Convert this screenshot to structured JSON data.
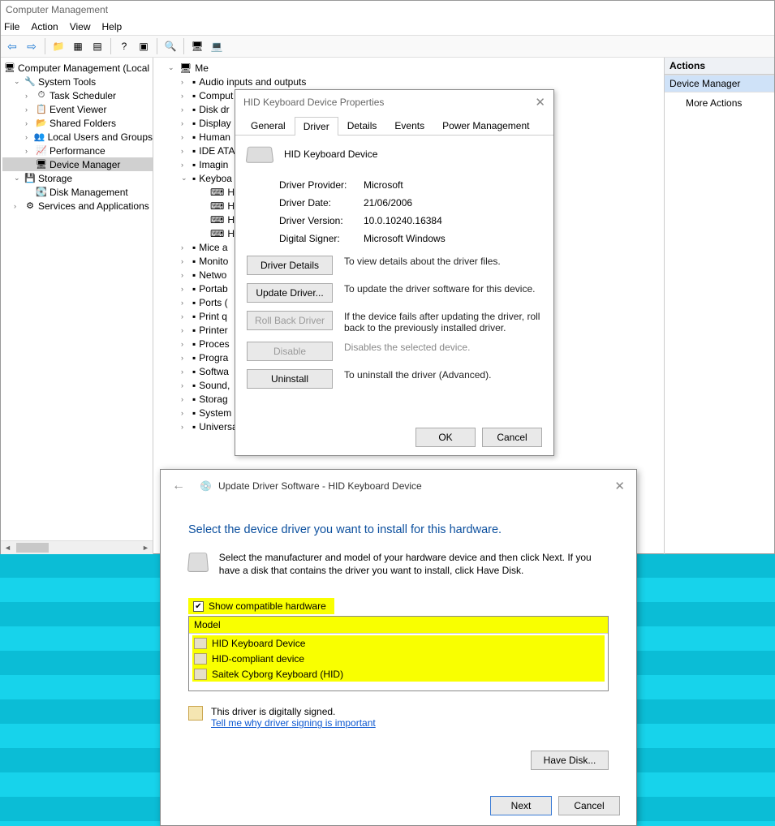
{
  "window": {
    "title": "Computer Management"
  },
  "menu": {
    "file": "File",
    "action": "Action",
    "view": "View",
    "help": "Help"
  },
  "left_tree": {
    "root": "Computer Management (Local",
    "system_tools": "System Tools",
    "task_scheduler": "Task Scheduler",
    "event_viewer": "Event Viewer",
    "shared_folders": "Shared Folders",
    "local_users": "Local Users and Groups",
    "performance": "Performance",
    "device_manager": "Device Manager",
    "storage": "Storage",
    "disk_management": "Disk Management",
    "services_apps": "Services and Applications"
  },
  "devices": {
    "root": "Me",
    "items": [
      "Audio inputs and outputs",
      "Comput",
      "Disk dr",
      "Display",
      "Human",
      "IDE ATA",
      "Imagin",
      "Keyboa"
    ],
    "hid": [
      "HID",
      "HID",
      "HID",
      "HID"
    ],
    "rest": [
      "Mice a",
      "Monito",
      "Netwo",
      "Portab",
      "Ports (",
      "Print q",
      "Printer",
      "Proces",
      "Progra",
      "Softwa",
      "Sound,",
      "Storag",
      "System",
      "Universal Serial Bus controllers"
    ]
  },
  "actions": {
    "header": "Actions",
    "selected": "Device Manager",
    "more": "More Actions"
  },
  "props": {
    "title": "HID Keyboard Device Properties",
    "tabs": {
      "general": "General",
      "driver": "Driver",
      "details": "Details",
      "events": "Events",
      "power": "Power Management"
    },
    "device_name": "HID Keyboard Device",
    "provider_lbl": "Driver Provider:",
    "provider_val": "Microsoft",
    "date_lbl": "Driver Date:",
    "date_val": "21/06/2006",
    "version_lbl": "Driver Version:",
    "version_val": "10.0.10240.16384",
    "signer_lbl": "Digital Signer:",
    "signer_val": "Microsoft Windows",
    "btn_details": "Driver Details",
    "desc_details": "To view details about the driver files.",
    "btn_update": "Update Driver...",
    "desc_update": "To update the driver software for this device.",
    "btn_rollback": "Roll Back Driver",
    "desc_rollback": "If the device fails after updating the driver, roll back to the previously installed driver.",
    "btn_disable": "Disable",
    "desc_disable": "Disables the selected device.",
    "btn_uninstall": "Uninstall",
    "desc_uninstall": "To uninstall the driver (Advanced).",
    "ok": "OK",
    "cancel": "Cancel"
  },
  "wizard": {
    "title": "Update Driver Software - HID Keyboard Device",
    "heading": "Select the device driver you want to install for this hardware.",
    "instruction": "Select the manufacturer and model of your hardware device and then click Next. If you have a disk that contains the driver you want to install, click Have Disk.",
    "show_compat": "Show compatible hardware",
    "model_header": "Model",
    "models": [
      "HID Keyboard Device",
      "HID-compliant device",
      "Saitek Cyborg Keyboard (HID)"
    ],
    "signed": "This driver is digitally signed.",
    "why_link": "Tell me why driver signing is important",
    "have_disk": "Have Disk...",
    "next": "Next",
    "cancel": "Cancel"
  }
}
